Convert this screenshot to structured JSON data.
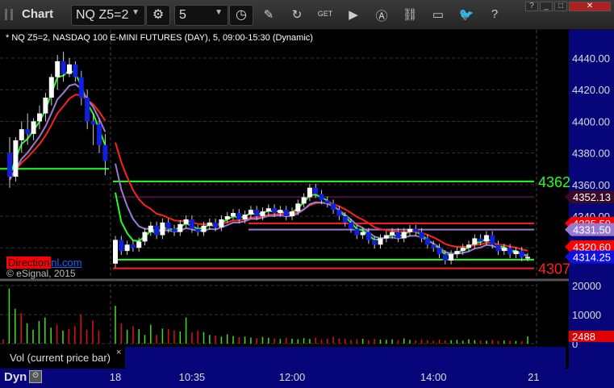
{
  "title": "Chart",
  "symbol": "NQ Z5=2",
  "interval": "5",
  "legend": "* NQ Z5=2, NASDAQ 100 E-MINI FUTURES (DAY), 5, 09:00-15:30 (Dynamic)",
  "watermark": {
    "red": "Direction",
    "blue": "nl.com"
  },
  "copyright": "© eSignal, 2015",
  "study_label": "Vol (current price bar)",
  "study_close": "×",
  "bottom": {
    "dyn": "Dyn",
    "lock": "⏲"
  },
  "time_labels": [
    {
      "t": "18",
      "bar": 17
    },
    {
      "t": "10:35",
      "bar": 30
    },
    {
      "t": "12:00",
      "bar": 47
    },
    {
      "t": "14:00",
      "bar": 71
    },
    {
      "t": "21",
      "bar": 88
    }
  ],
  "price_axis": {
    "ticks": [
      4440,
      4420,
      4400,
      4380,
      4360,
      4340,
      4320
    ],
    "min": 4300,
    "max": 4458
  },
  "price_tick_labels": [
    "4440.00",
    "4420.00",
    "4400.00",
    "4380.00",
    "4360.00",
    "4340.00",
    "4320.00"
  ],
  "price_flags": [
    {
      "label": "4352.13",
      "value": 4352.13,
      "color": "#3a0a2a"
    },
    {
      "label": "4335.50",
      "value": 4335.5,
      "color": "#ff0000"
    },
    {
      "label": "4331.50",
      "value": 4331.5,
      "color": "#9a7ad0"
    },
    {
      "label": "4320.60",
      "value": 4320.6,
      "color": "#ff0000"
    },
    {
      "label": "4314.25",
      "value": 4314.25,
      "color": "#1010e0"
    }
  ],
  "level_labels": [
    {
      "label": "4362",
      "value": 4362,
      "color": "#22ff22"
    },
    {
      "label": "4307",
      "value": 4307,
      "color": "#ff2020"
    }
  ],
  "volume_axis": {
    "ticks": [
      "20000",
      "10000",
      "0"
    ],
    "max": 22000,
    "current": "2488"
  },
  "colors": {
    "up": "#ffffff",
    "down": "#1020e0",
    "vol_up": "#44dd22",
    "vol_down": "#dd1111",
    "axis_bg": "#06067a"
  },
  "chart_data": {
    "type": "candlestick",
    "day1_ohlc": [
      [
        4380,
        4390,
        4358,
        4365
      ],
      [
        4365,
        4390,
        4362,
        4388
      ],
      [
        4388,
        4400,
        4380,
        4395
      ],
      [
        4395,
        4405,
        4385,
        4392
      ],
      [
        4392,
        4402,
        4388,
        4400
      ],
      [
        4400,
        4410,
        4395,
        4405
      ],
      [
        4405,
        4418,
        4400,
        4415
      ],
      [
        4415,
        4430,
        4410,
        4428
      ],
      [
        4428,
        4442,
        4420,
        4438
      ],
      [
        4438,
        4444,
        4425,
        4430
      ],
      [
        4430,
        4440,
        4428,
        4436
      ],
      [
        4436,
        4438,
        4425,
        4428
      ],
      [
        4428,
        4432,
        4410,
        4415
      ],
      [
        4415,
        4420,
        4395,
        4400
      ],
      [
        4400,
        4405,
        4385,
        4398
      ],
      [
        4398,
        4402,
        4380,
        4385
      ],
      [
        4385,
        4392,
        4366,
        4375
      ]
    ],
    "day2_open": 4310,
    "day2_closes": [
      4325,
      4318,
      4322,
      4320,
      4324,
      4330,
      4334,
      4328,
      4336,
      4332,
      4330,
      4335,
      4338,
      4332,
      4330,
      4334,
      4336,
      4333,
      4338,
      4340,
      4342,
      4338,
      4341,
      4344,
      4340,
      4343,
      4345,
      4342,
      4344,
      4340,
      4343,
      4348,
      4352,
      4358,
      4354,
      4350,
      4348,
      4344,
      4340,
      4336,
      4332,
      4328,
      4330,
      4325,
      4322,
      4326,
      4328,
      4330,
      4326,
      4330,
      4332,
      4330,
      4326,
      4322,
      4320,
      4316,
      4312,
      4316,
      4318,
      4320,
      4322,
      4326,
      4324,
      4328,
      4322,
      4318,
      4320,
      4316,
      4318,
      4314,
      4314.25
    ],
    "volume": [
      1500,
      19000,
      12000,
      10500,
      7000,
      4800,
      7800,
      9000,
      5500,
      6500,
      4500,
      5000,
      6000,
      10000,
      4800,
      8000,
      4500,
      13000,
      7000,
      4800,
      6000,
      5000,
      3000,
      6500,
      3000,
      5200,
      5000,
      4600,
      4200,
      9000,
      3800,
      4500,
      4000,
      3000,
      2800,
      2400,
      3200,
      2600,
      2200,
      2400,
      2100,
      1900,
      2300,
      2000,
      1800,
      1600,
      2000,
      1700,
      1500,
      1900,
      1600,
      2100,
      1400,
      1700,
      2400,
      1800,
      1600,
      1300,
      1500,
      1700,
      1200,
      1600,
      1400,
      1300,
      1500,
      1200,
      1800,
      1300,
      1100,
      1500,
      1200,
      1000,
      1400,
      1100,
      1200,
      1300,
      1000,
      1500,
      1200,
      1100,
      1000,
      1300,
      900,
      1100,
      1000,
      900,
      800,
      2488
    ],
    "levels": [
      {
        "value": 4362,
        "color": "#22ff22",
        "from_bar": 17
      },
      {
        "value": 4312.5,
        "color": "#22ff22",
        "from_bar": 17
      },
      {
        "value": 4307,
        "color": "#ff2020",
        "from_bar": 17
      },
      {
        "value": 4370,
        "color": "#22ff22",
        "to_bar": 17
      },
      {
        "value": 4352.13,
        "color": "#4a1040",
        "from_bar": 17
      },
      {
        "value": 4335.5,
        "color": "#ff2020",
        "from_bar": 40
      },
      {
        "value": 4331.5,
        "color": "#9a7ad0",
        "from_bar": 40
      }
    ]
  }
}
